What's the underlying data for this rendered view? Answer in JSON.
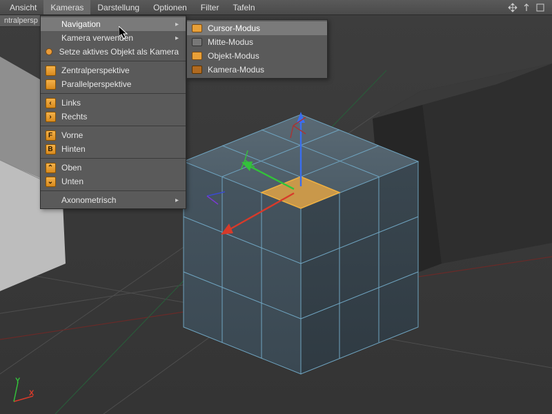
{
  "menubar": {
    "items": [
      {
        "label": "Ansicht"
      },
      {
        "label": "Kameras"
      },
      {
        "label": "Darstellung"
      },
      {
        "label": "Optionen"
      },
      {
        "label": "Filter"
      },
      {
        "label": "Tafeln"
      }
    ],
    "open_index": 1
  },
  "viewlabel": "ntralpersp",
  "cameras_menu": {
    "navigation": "Navigation",
    "kamera_verwenden": "Kamera verwenden",
    "aktives_objekt": "Setze aktives Objekt als Kamera",
    "zentralperspektive": "Zentralperspektive",
    "parallelperspektive": "Parallelperspektive",
    "links": "Links",
    "rechts": "Rechts",
    "vorne": "Vorne",
    "hinten": "Hinten",
    "oben": "Oben",
    "unten": "Unten",
    "axonometrisch": "Axonometrisch"
  },
  "badges": {
    "links": "‹",
    "rechts": "›",
    "vorne": "F",
    "hinten": "B",
    "oben": "⌃",
    "unten": "⌄"
  },
  "nav_submenu": {
    "cursor": "Cursor-Modus",
    "mitte": "Mitte-Modus",
    "objekt": "Objekt-Modus",
    "kamera": "Kamera-Modus"
  },
  "axis_labels": {
    "x": "X",
    "y": "Y"
  },
  "colors": {
    "axis_x": "#d83a2a",
    "axis_y": "#33c23a",
    "axis_z": "#3a6ef0",
    "wire": "#6fa4c0",
    "face_sel": "#c9984a",
    "face_sel_edge": "#f0b040"
  }
}
